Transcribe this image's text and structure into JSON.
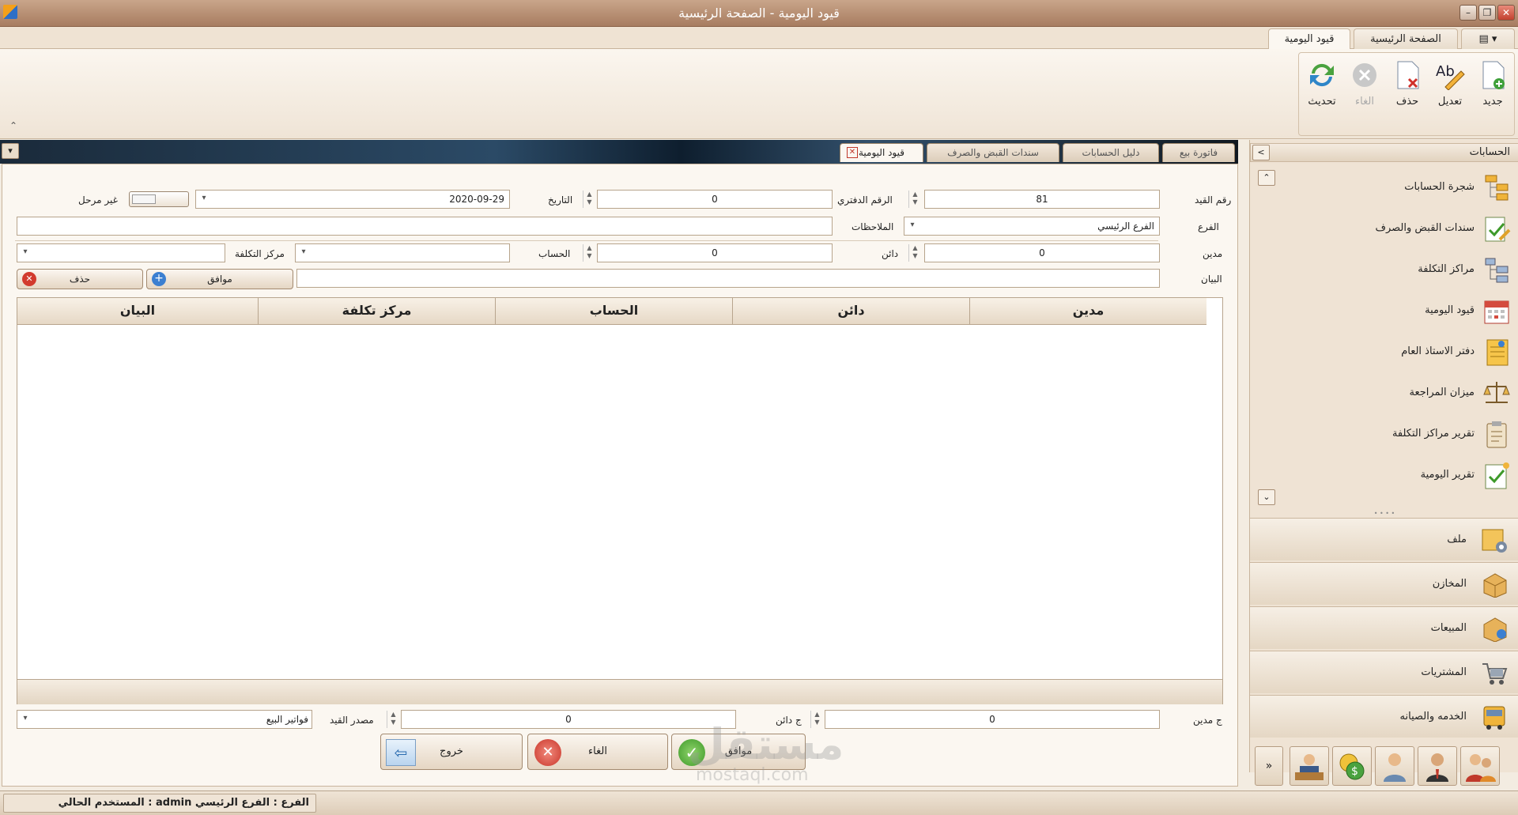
{
  "window": {
    "title": "قيود اليومية - الصفحة الرئيسية"
  },
  "ribbon": {
    "tabs": [
      "قيود اليومية",
      "الصفحة الرئيسية"
    ],
    "buttons": [
      {
        "label": "جديد",
        "icon": "new-document-icon"
      },
      {
        "label": "تعديل",
        "icon": "edit-icon"
      },
      {
        "label": "حذف",
        "icon": "delete-document-icon"
      },
      {
        "label": "الغاء",
        "icon": "cancel-icon"
      },
      {
        "label": "تحديث",
        "icon": "refresh-icon"
      }
    ]
  },
  "nav": {
    "header": "الحسابات",
    "items": [
      {
        "label": "شجرة الحسابات",
        "icon": "account-tree-icon"
      },
      {
        "label": "سندات القبض والصرف",
        "icon": "vouchers-icon"
      },
      {
        "label": "مراكز التكلفة",
        "icon": "cost-centers-icon"
      },
      {
        "label": "قيود اليومية",
        "icon": "calendar-icon"
      },
      {
        "label": "دفتر الاستاذ العام",
        "icon": "ledger-icon"
      },
      {
        "label": "ميزان المراجعة",
        "icon": "balance-scale-icon"
      },
      {
        "label": "تقرير مراكز التكلفة",
        "icon": "clipboard-icon"
      },
      {
        "label": "تقرير اليومية",
        "icon": "report-icon"
      }
    ],
    "groups": [
      {
        "label": "ملف",
        "icon": "file-settings-icon"
      },
      {
        "label": "المخازن",
        "icon": "boxes-icon"
      },
      {
        "label": "المبيعات",
        "icon": "sales-box-icon"
      },
      {
        "label": "المشتريات",
        "icon": "cart-icon"
      },
      {
        "label": "الخدمه والصيانه",
        "icon": "bus-icon"
      }
    ]
  },
  "doc_tabs": [
    "فاتورة بيع",
    "دليل الحسابات",
    "سندات القبض والصرف",
    "قيود اليومية"
  ],
  "form": {
    "entry_no_label": "رقم القيد",
    "entry_no": "81",
    "book_no_label": "الرقم الدفتري",
    "book_no": "0",
    "date_label": "التاريخ",
    "date": "2020-09-29",
    "unposted_label": "غير مرحل",
    "branch_label": "الفرع",
    "branch": "الفرع الرئيسي",
    "notes_label": "الملاحظات",
    "debit_label": "مدين",
    "debit": "0",
    "credit_label": "دائن",
    "credit": "0",
    "account_label": "الحساب",
    "cost_center_label": "مركز التكلفة",
    "statement_label": "البيان",
    "ok_label": "موافق",
    "delete_label": "حذف",
    "total_debit_label": "ج مدين",
    "total_debit": "0",
    "total_credit_label": "ج دائن",
    "total_credit": "0",
    "source_label": "مصدر القيد",
    "source": "فواتير البيع"
  },
  "grid": {
    "columns": [
      "مدين",
      "دائن",
      "الحساب",
      "مركز تكلفة",
      "البيان"
    ]
  },
  "actions": {
    "ok": "موافق",
    "cancel": "الغاء",
    "exit": "خروج"
  },
  "status": {
    "text": "المستخدم الحالي :  admin   الفرع  :  الفرع الرئيسي"
  },
  "watermark": {
    "text": "مستقل",
    "sub": "mostaql.com"
  }
}
